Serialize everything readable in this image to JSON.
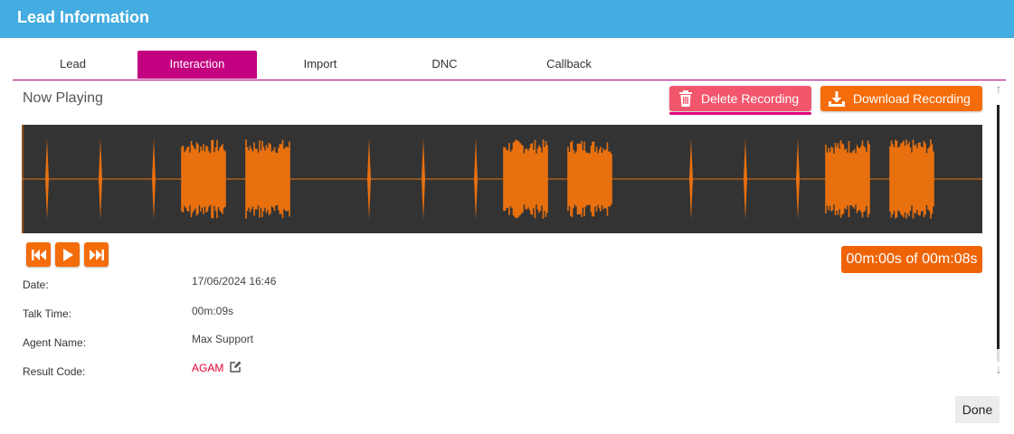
{
  "window": {
    "title": "Lead Information"
  },
  "tabs": [
    {
      "label": "Lead"
    },
    {
      "label": "Interaction",
      "active": true
    },
    {
      "label": "Import"
    },
    {
      "label": "DNC"
    },
    {
      "label": "Callback"
    }
  ],
  "player": {
    "heading": "Now Playing",
    "delete_label": "Delete Recording",
    "download_label": "Download Recording",
    "timer": "00m:00s of 00m:08s",
    "progress": 0,
    "controls": [
      "rewind-icon",
      "play-icon",
      "fast-forward-icon"
    ]
  },
  "details": [
    {
      "label": "Date:",
      "value": "17/06/2024 16:46"
    },
    {
      "label": "Talk Time:",
      "value": "00m:09s"
    },
    {
      "label": "Agent Name:",
      "value": "Max Support"
    },
    {
      "label": "Result Code:",
      "value": "AGAM"
    }
  ],
  "footer": {
    "done_label": "Done"
  },
  "colors": {
    "titlebar": "#43ace0",
    "active_tab": "#c20080",
    "delete": "#f2566c",
    "accent": "#f56c0b",
    "waveform": "#e8700f",
    "waveform_bg": "#333333",
    "result_code": "#e2003a"
  }
}
